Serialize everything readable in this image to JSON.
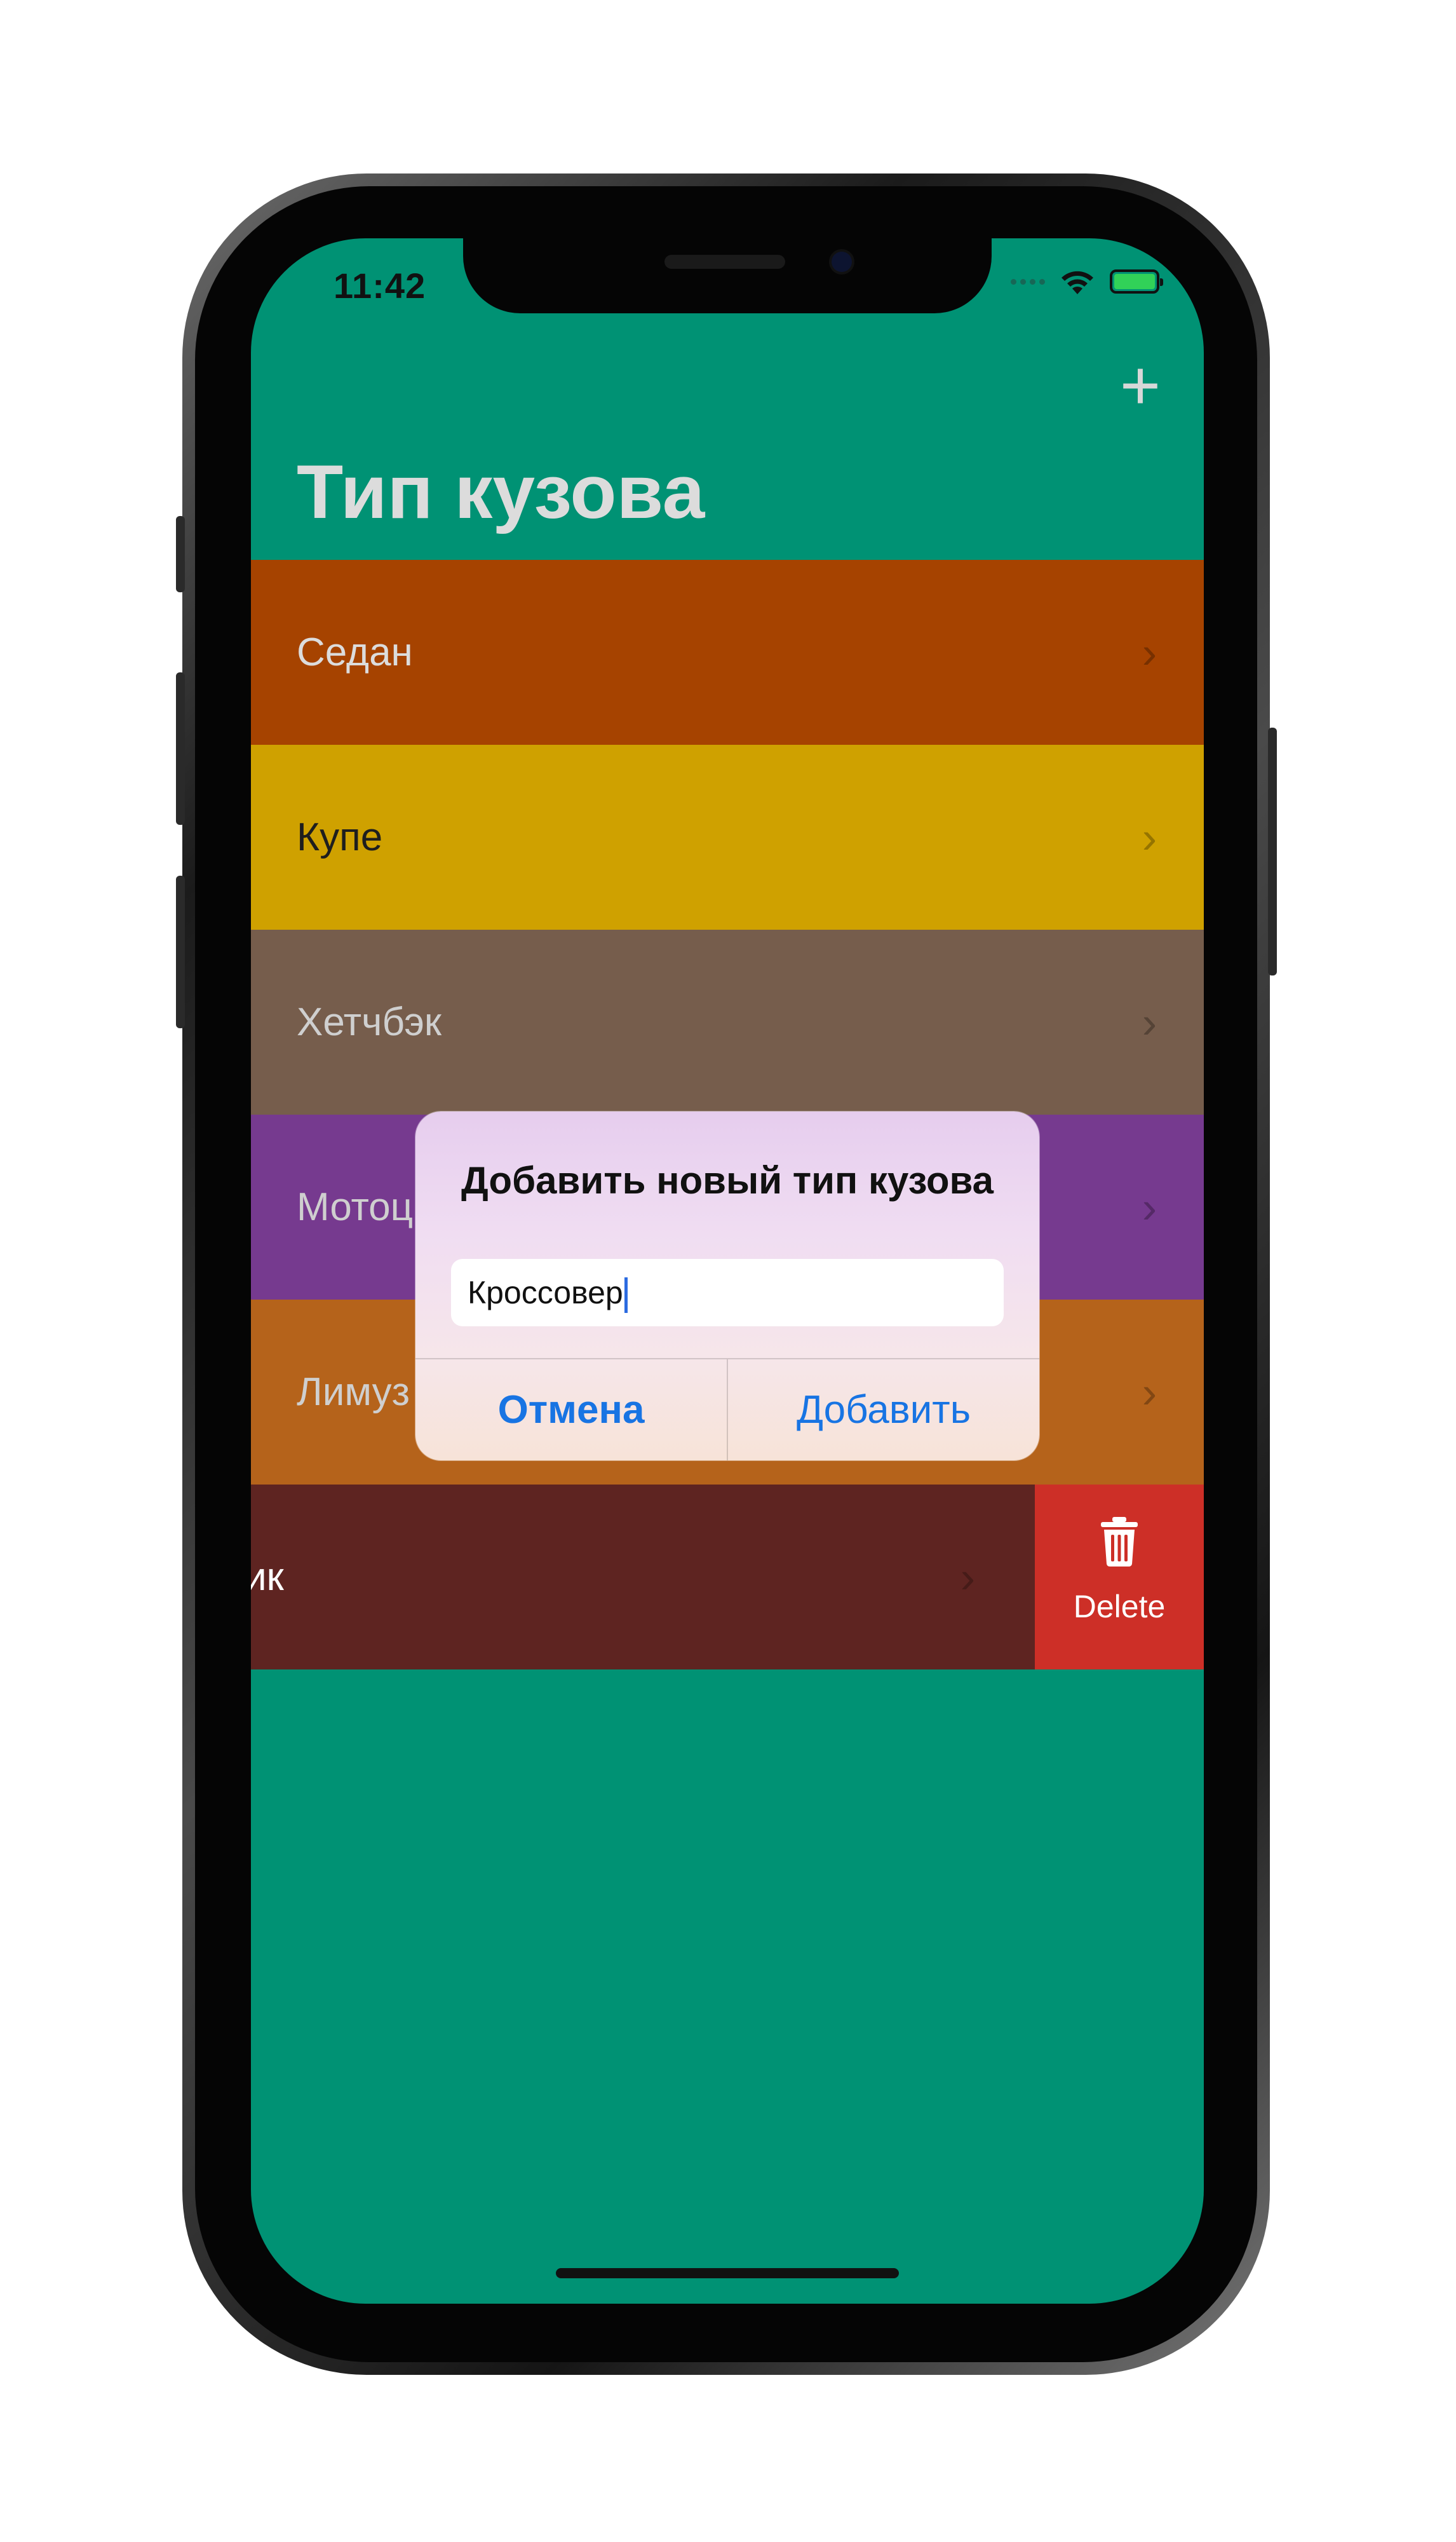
{
  "status_bar": {
    "time": "11:42"
  },
  "nav": {
    "title": "Тип кузова",
    "add_button": "+"
  },
  "rows": [
    {
      "label": "Седан",
      "color": "#a64300",
      "text_color": "#dcdcdc"
    },
    {
      "label": "Купе",
      "color": "#cfa100",
      "text_color": "#1e1e1e"
    },
    {
      "label": "Хетчбэк",
      "color": "#765d4c",
      "text_color": "#cfcfcf"
    },
    {
      "label": "Мотоц",
      "color": "#763a8f",
      "text_color": "#cfcfcf"
    },
    {
      "label": "Лимуз",
      "color": "#b5631b",
      "text_color": "#cfcfcf"
    },
    {
      "label": "ик",
      "color": "#5e2421",
      "text_color": "#ffffff"
    }
  ],
  "delete_action": {
    "label": "Delete",
    "color": "#cd2f27"
  },
  "alert": {
    "title": "Добавить новый тип кузова",
    "input_value": "Кроссовер",
    "cancel_label": "Отмена",
    "add_label": "Добавить"
  },
  "colors": {
    "background": "#009274",
    "accent": "#1874e3"
  }
}
